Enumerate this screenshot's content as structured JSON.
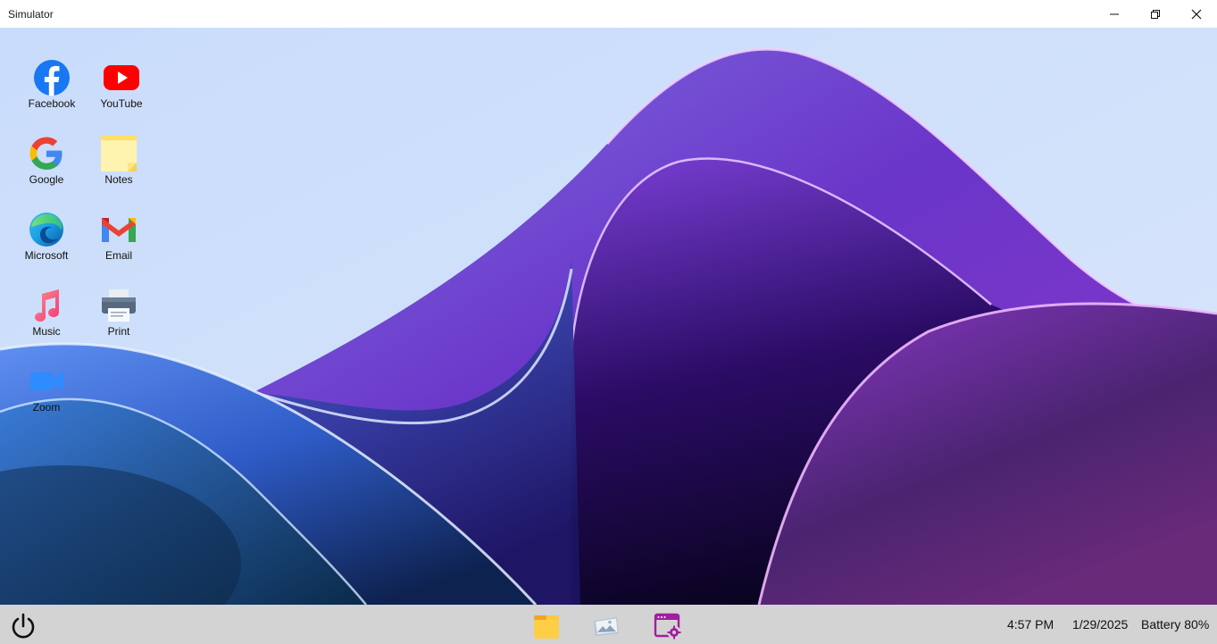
{
  "window": {
    "title": "Simulator"
  },
  "desktop": {
    "apps": [
      {
        "label": "Facebook",
        "icon": "facebook-icon"
      },
      {
        "label": "YouTube",
        "icon": "youtube-icon"
      },
      {
        "label": "Google",
        "icon": "google-icon"
      },
      {
        "label": "Notes",
        "icon": "notes-icon"
      },
      {
        "label": "Microsoft",
        "icon": "edge-icon"
      },
      {
        "label": "Email",
        "icon": "gmail-icon"
      },
      {
        "label": "Music",
        "icon": "music-icon"
      },
      {
        "label": "Print",
        "icon": "printer-icon"
      },
      {
        "label": "Zoom",
        "icon": "zoom-icon"
      }
    ]
  },
  "taskbar": {
    "time": "4:57 PM",
    "date": "1/29/2025",
    "battery": "Battery 80%",
    "pinned": [
      "file-explorer-icon",
      "photo-viewer-icon",
      "settings-window-icon"
    ]
  },
  "colors": {
    "taskbar_bg": "#d3d3d3",
    "wallpaper_sky": "#cfe0fb",
    "wallpaper_purple": "#7b2fd0",
    "wallpaper_blue": "#3a6fe0"
  }
}
